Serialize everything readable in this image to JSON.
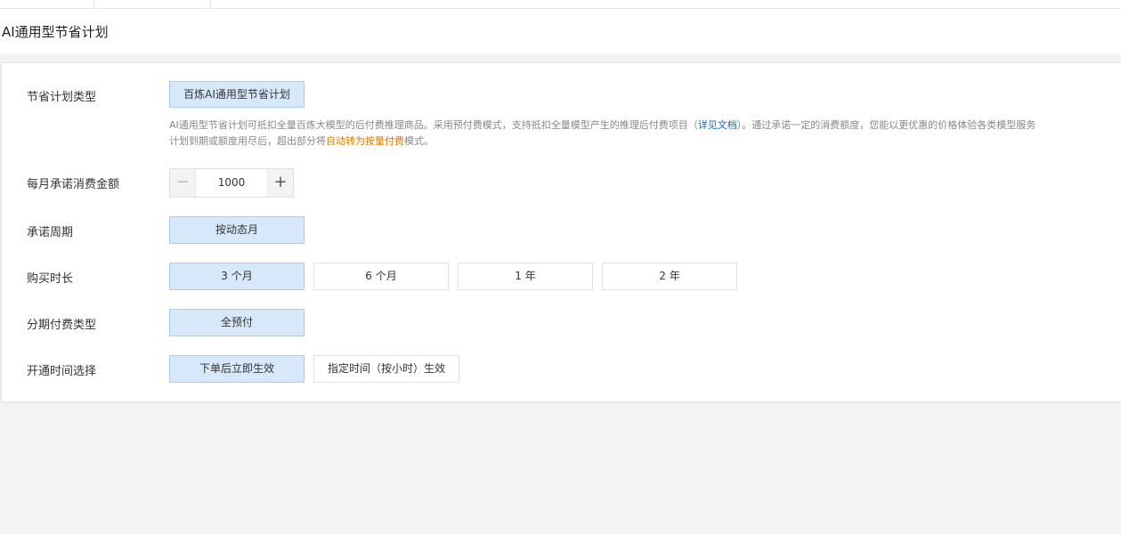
{
  "page_title": "AI通用型节省计划",
  "rows": {
    "plan_type": {
      "label": "节省计划类型",
      "option": "百炼AI通用型节省计划",
      "desc_part1": "AI通用型节省计划可抵扣全量百炼大模型的后付费推理商品。采用预付费模式，支持抵扣全量模型产生的推理后付费项目（",
      "desc_link": "详见文档",
      "desc_part2": "）。通过承诺一定的消费额度，您能以更优惠的价格体验各类模型服务",
      "desc_line2_part1": "计划到期或额度用尽后，超出部分将",
      "desc_line2_highlight": "自动转为按量付费",
      "desc_line2_part2": "模式。"
    },
    "monthly_amount": {
      "label": "每月承诺消费金额",
      "value": "1000",
      "minus": "−",
      "plus": "+"
    },
    "period": {
      "label": "承诺周期",
      "option": "按动态月"
    },
    "duration": {
      "label": "购买时长",
      "options": [
        "3 个月",
        "6 个月",
        "1 年",
        "2 年"
      ],
      "selected": "3 个月"
    },
    "payment_type": {
      "label": "分期付费类型",
      "option": "全预付"
    },
    "activation": {
      "label": "开通时间选择",
      "options": [
        "下单后立即生效",
        "指定时间（按小时）生效"
      ],
      "selected": "下单后立即生效"
    }
  },
  "colors": {
    "selected_bg": "#d6e8fa",
    "selected_border": "#a9cdf2",
    "link": "#0a66c2",
    "highlight": "#e07b00",
    "page_bg": "#f2f3f5"
  }
}
